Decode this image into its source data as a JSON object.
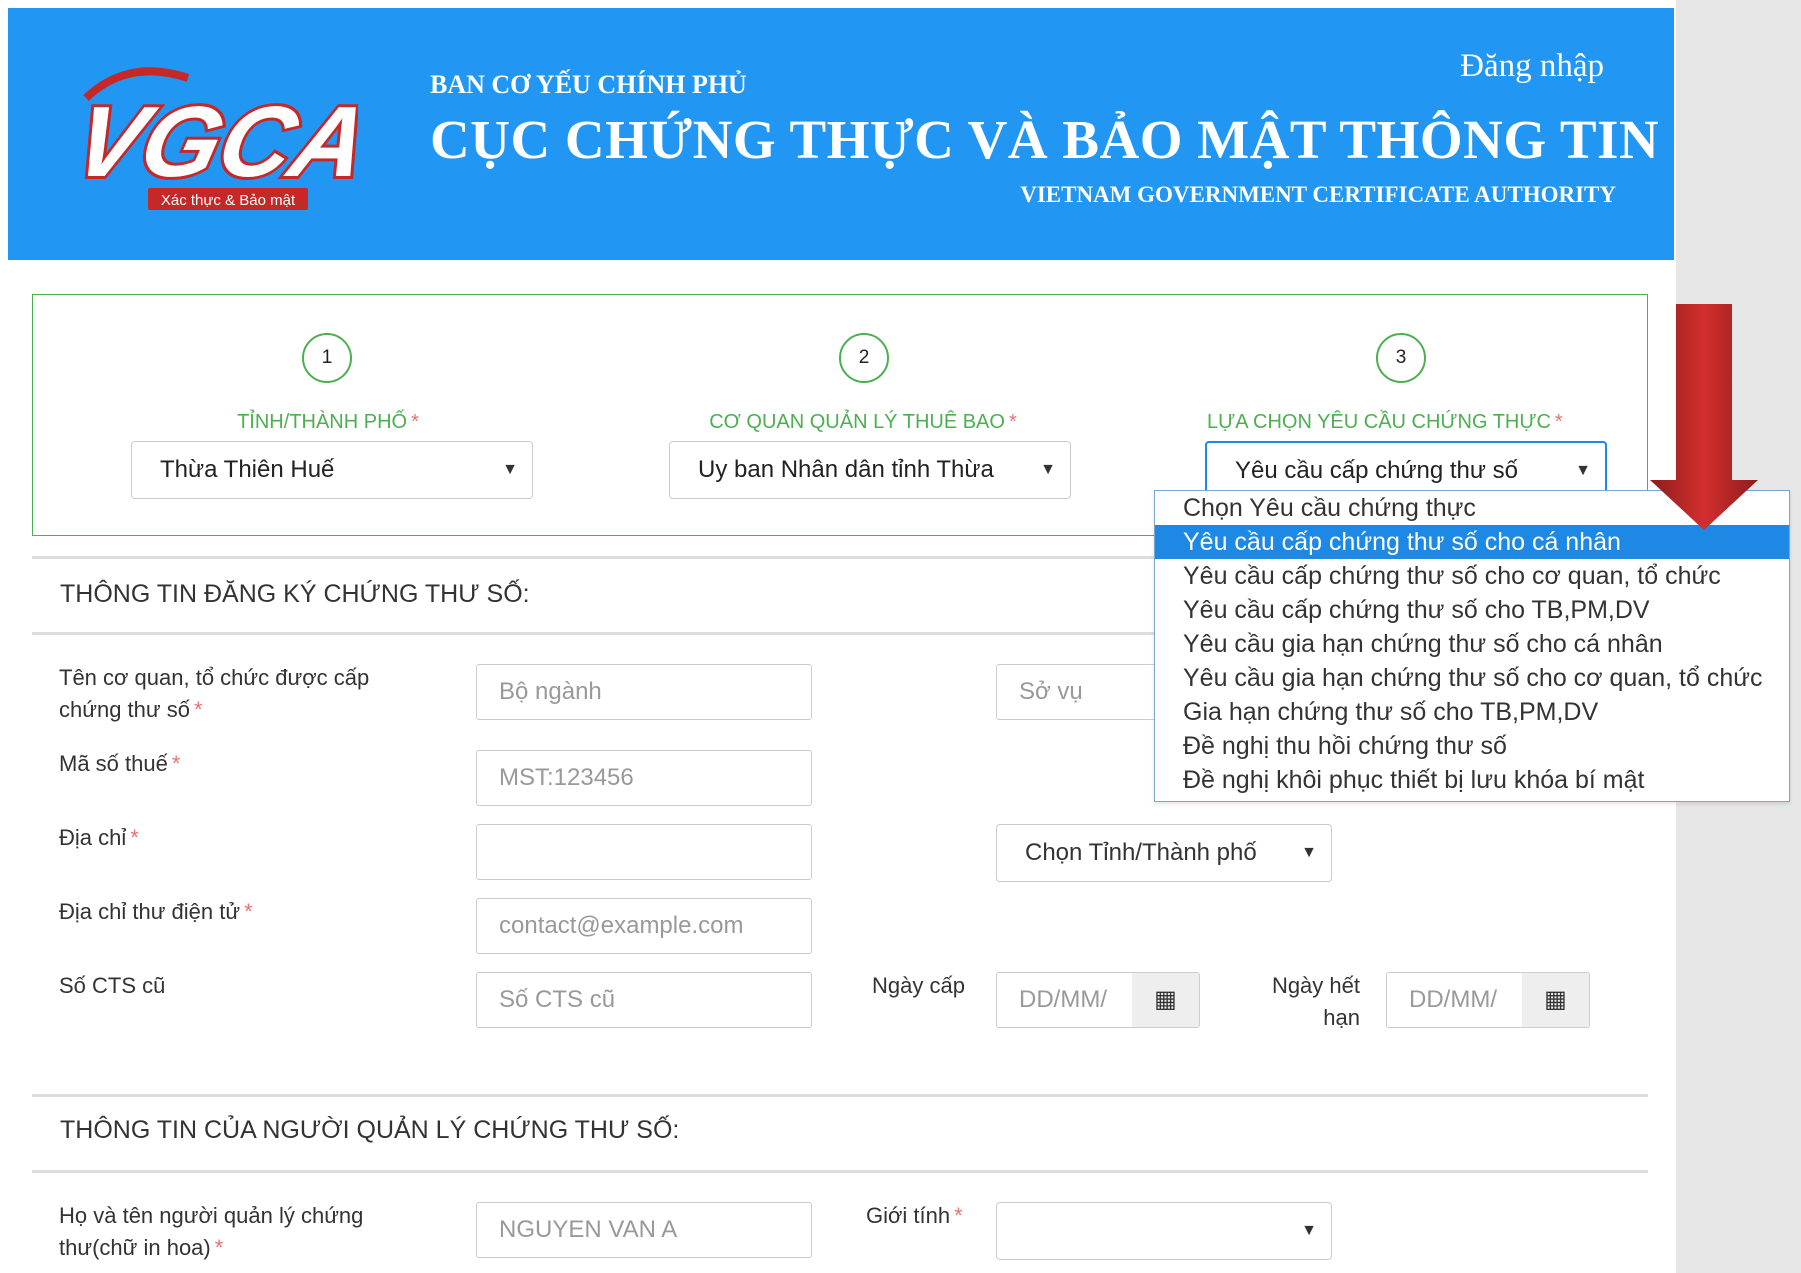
{
  "header": {
    "org": "BAN CƠ YẾU CHÍNH PHỦ",
    "title": "CỤC CHỨNG THỰC VÀ BẢO MẬT THÔNG TIN",
    "subtitle": "VIETNAM GOVERNMENT CERTIFICATE AUTHORITY",
    "login": "Đăng nhập",
    "logo_text": "VGCA",
    "logo_tagline": "Xác thực & Bảo mật"
  },
  "steps": [
    {
      "num": "1",
      "label": "TỈNH/THÀNH PHỐ",
      "selected": "Thừa Thiên Huế"
    },
    {
      "num": "2",
      "label": "CƠ QUAN QUẢN LÝ THUÊ BAO",
      "selected": "Uy ban Nhân dân tỉnh Thừa"
    },
    {
      "num": "3",
      "label": "LỰA CHỌN YÊU CẦU CHỨNG THỰC",
      "selected": "Yêu cầu cấp chứng thư số"
    }
  ],
  "required_mark": "*",
  "dropdown": {
    "options": [
      "Chọn Yêu cầu chứng thực",
      "Yêu cầu cấp chứng thư số cho cá nhân",
      "Yêu cầu cấp chứng thư số cho cơ quan, tổ chức",
      "Yêu cầu cấp chứng thư số cho TB,PM,DV",
      "Yêu cầu gia hạn chứng thư số cho cá nhân",
      "Yêu cầu gia hạn chứng thư số cho cơ quan, tổ chức",
      "Gia hạn chứng thư số cho TB,PM,DV",
      "Đề nghị thu hồi chứng thư số",
      "Đề nghị khôi phục thiết bị lưu khóa bí mật"
    ],
    "highlighted": "Yêu cầu cấp chứng thư số cho cá nhân"
  },
  "section1": {
    "title": "THÔNG TIN ĐĂNG KÝ CHỨNG THƯ SỐ:",
    "org_label_line1": "Tên cơ quan, tổ chức được cấp",
    "org_label_line2": "chứng thư số",
    "org_placeholder1": "Bộ ngành",
    "org_placeholder2": "Sở vụ",
    "tax_label": "Mã số thuế",
    "tax_placeholder": "MST:123456",
    "address_label": "Địa chỉ",
    "province_select": "Chọn Tỉnh/Thành phố",
    "email_label": "Địa chỉ thư điện tử",
    "email_placeholder": "contact@example.com",
    "old_cert_label": "Số CTS cũ",
    "old_cert_placeholder": "Số CTS cũ",
    "issue_date_label": "Ngày cấp",
    "issue_date_placeholder": "DD/MM/",
    "expiry_label_line1": "Ngày hết",
    "expiry_label_line2": "hạn",
    "expiry_placeholder": "DD/MM/"
  },
  "section2": {
    "title": "THÔNG TIN CỦA NGƯỜI QUẢN LÝ CHỨNG THƯ SỐ:",
    "name_label_line1": "Họ và tên người quản lý chứng",
    "name_label_line2": "thư(chữ in hoa)",
    "name_placeholder": "NGUYEN VAN A",
    "gender_label": "Giới tính",
    "gender_value": ""
  },
  "icons": {
    "calendar": "calendar-icon",
    "caret": "chevron-down-icon",
    "arrow": "arrow-down-icon"
  },
  "colors": {
    "header_bg": "#2196f3",
    "step_green": "#4caf50",
    "highlight_blue": "#1e88e5",
    "arrow_red": "#c62828"
  }
}
